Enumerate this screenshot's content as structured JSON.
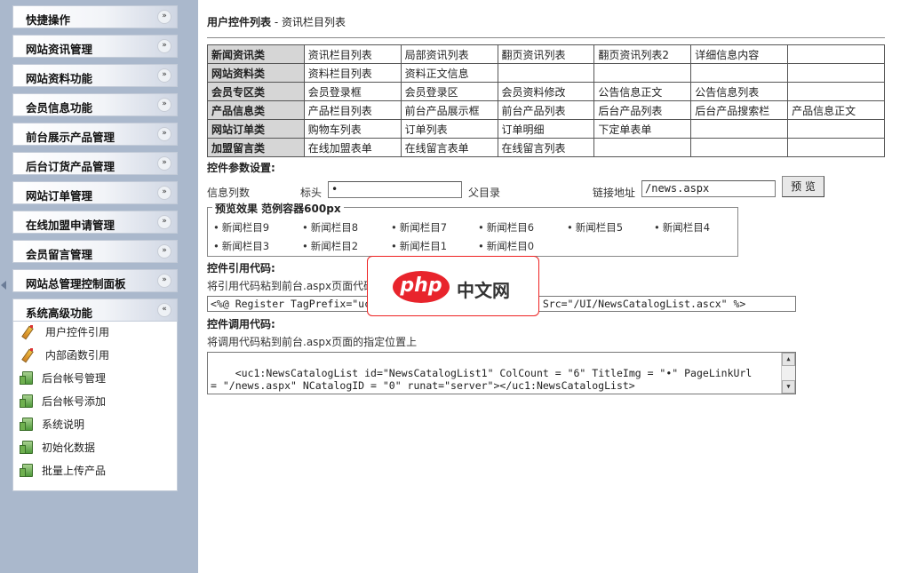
{
  "sidebar": {
    "menus": [
      {
        "label": "快捷操作",
        "chevron": "expand"
      },
      {
        "label": "网站资讯管理",
        "chevron": "expand"
      },
      {
        "label": "网站资料功能",
        "chevron": "expand"
      },
      {
        "label": "会员信息功能",
        "chevron": "expand"
      },
      {
        "label": "前台展示产品管理",
        "chevron": "expand"
      },
      {
        "label": "后台订货产品管理",
        "chevron": "expand"
      },
      {
        "label": "网站订单管理",
        "chevron": "expand"
      },
      {
        "label": "在线加盟申请管理",
        "chevron": "expand"
      },
      {
        "label": "会员留言管理",
        "chevron": "expand"
      },
      {
        "label": "网站总管理控制面板",
        "chevron": "expand"
      },
      {
        "label": "系统高级功能",
        "chevron": "collapse"
      }
    ],
    "chevron_expand": "»",
    "chevron_collapse": "«",
    "submenu": [
      {
        "label": "用户控件引用",
        "icon": "pencil-icon"
      },
      {
        "label": "内部函数引用",
        "icon": "pencil-icon"
      },
      {
        "label": "后台帐号管理",
        "icon": "document-icon"
      },
      {
        "label": "后台帐号添加",
        "icon": "document-icon"
      },
      {
        "label": "系统说明",
        "icon": "document-icon"
      },
      {
        "label": "初始化数据",
        "icon": "document-icon"
      },
      {
        "label": "批量上传产品",
        "icon": "document-icon"
      }
    ]
  },
  "main": {
    "title": "用户控件列表",
    "title_sep": " - ",
    "subtitle": "资讯栏目列表",
    "categories": [
      {
        "head": "新闻资讯类",
        "cells": [
          "资讯栏目列表",
          "局部资讯列表",
          "翻页资讯列表",
          "翻页资讯列表2",
          "详细信息内容",
          ""
        ]
      },
      {
        "head": "网站资料类",
        "cells": [
          "资料栏目列表",
          "资料正文信息",
          "",
          "",
          "",
          ""
        ]
      },
      {
        "head": "会员专区类",
        "cells": [
          "会员登录框",
          "会员登录区",
          "会员资料修改",
          "公告信息正文",
          "公告信息列表",
          ""
        ]
      },
      {
        "head": "产品信息类",
        "cells": [
          "产品栏目列表",
          "前台产品展示框",
          "前台产品列表",
          "后台产品列表",
          "后台产品搜索栏",
          "产品信息正文"
        ]
      },
      {
        "head": "网站订单类",
        "cells": [
          "购物车列表",
          "订单列表",
          "订单明细",
          "下定单表单",
          "",
          ""
        ]
      },
      {
        "head": "加盟留言类",
        "cells": [
          "在线加盟表单",
          "在线留言表单",
          "在线留言列表",
          "",
          "",
          ""
        ]
      }
    ],
    "params": {
      "heading": "控件参数设置:",
      "count_label": "信息列数",
      "bullet_label": "标头",
      "bullet_value": "•",
      "parent_label": "父目录",
      "link_label": "链接地址",
      "link_value": "/news.aspx",
      "preview_button": "预 览"
    },
    "preview": {
      "legend": "预览效果 范例容器600px",
      "items": [
        "新闻栏目9",
        "新闻栏目8",
        "新闻栏目7",
        "新闻栏目6",
        "新闻栏目5",
        "新闻栏目4",
        "新闻栏目3",
        "新闻栏目2",
        "新闻栏目1",
        "新闻栏目0"
      ]
    },
    "register": {
      "heading": "控件引用代码:",
      "hint": "将引用代码粘到前台.aspx页面代码",
      "code_visible_left": "<%@ Register TagPrefix=\"uc",
      "code_visible_right": "\" Src=\"/UI/NewsCatalogList.ascx\" %>"
    },
    "call": {
      "heading": "控件调用代码:",
      "hint": "将调用代码粘到前台.aspx页面的指定位置上",
      "code": "<uc1:NewsCatalogList id=\"NewsCatalogList1\" ColCount = \"6\" TitleImg = \"•\" PageLinkUrl\n= \"/news.aspx\" NCatalogID = \"0\" runat=\"server\"></uc1:NewsCatalogList>"
    }
  },
  "watermark": {
    "logo_text": "php",
    "cn_text": "中文网"
  }
}
